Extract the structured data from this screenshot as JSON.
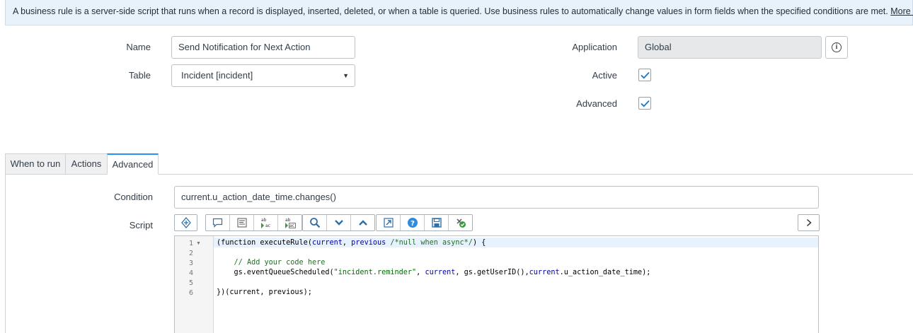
{
  "banner": {
    "text": "A business rule is a server-side script that runs when a record is displayed, inserted, deleted, or when a table is queried. Use business rules to automatically change values in form fields when the specified conditions are met.",
    "link": "More Info"
  },
  "form": {
    "name_label": "Name",
    "name_value": "Send Notification for Next Action",
    "table_label": "Table",
    "table_value": "Incident [incident]",
    "application_label": "Application",
    "application_value": "Global",
    "active_label": "Active",
    "active_checked": true,
    "advanced_label": "Advanced",
    "advanced_checked": true
  },
  "tabs": [
    {
      "label": "When to run",
      "active": false
    },
    {
      "label": "Actions",
      "active": false
    },
    {
      "label": "Advanced",
      "active": true
    }
  ],
  "advanced": {
    "condition_label": "Condition",
    "condition_value": "current.u_action_date_time.changes()",
    "script_label": "Script"
  },
  "toolbar_icons": [
    "toggle-syntax-icon",
    "comment-icon",
    "format-code-icon",
    "replace-icon",
    "replace-all-icon",
    "search-icon",
    "next-icon",
    "previous-icon",
    "open-script-icon",
    "help-icon",
    "save-icon",
    "script-debugger-icon",
    "expand-icon"
  ],
  "editor": {
    "line_numbers": [
      "1",
      "2",
      "3",
      "4",
      "5",
      "6"
    ]
  },
  "colors": {
    "banner_bg": "#e8f2fb",
    "tab_accent": "#278efc",
    "icon_blue": "#2e6fa8",
    "checkmark": "#1f75c2"
  }
}
